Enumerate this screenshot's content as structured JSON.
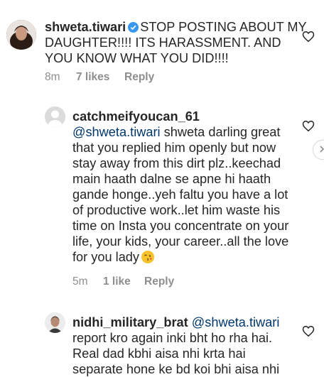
{
  "comments": [
    {
      "username": "shweta.tiwari",
      "verified": true,
      "text": "STOP POSTING ABOUT MY DAUGHTER!!!! ITS HARASSMENT. AND YOU KNOW WHAT YOU DID!!!!",
      "time": "8m",
      "likes": "7 likes",
      "reply": "Reply"
    },
    {
      "username": "catchmeifyoucan_61",
      "mention": "@shweta.tiwari",
      "text": "shweta darling great that you replied him openly but now stay away from this dirt plz..keechad main haath dalne se apne hi haath gande honge..yeh faltu you have a lot of productive work..let him waste his time on Insta you concentrate on your life, your kids, your career..all the love for you lady",
      "emoji": "face-blowing-a-kiss",
      "time": "5m",
      "likes": "1 like",
      "reply": "Reply"
    },
    {
      "username": "nidhi_military_brat",
      "mention": "@shweta.tiwari",
      "text": "report kro again inki bht ho rha hai. Real dad kbhi aisa nhi krta hai separate hone ke bd koi bhi aisa nhi"
    }
  ],
  "icons": {
    "like": "heart-outline-icon",
    "verified": "verified-badge-icon",
    "next": "chevron-right-icon"
  },
  "colors": {
    "text": "#262626",
    "meta": "#8e8e8e",
    "mention": "#00376b",
    "verified": "#3897f0"
  }
}
